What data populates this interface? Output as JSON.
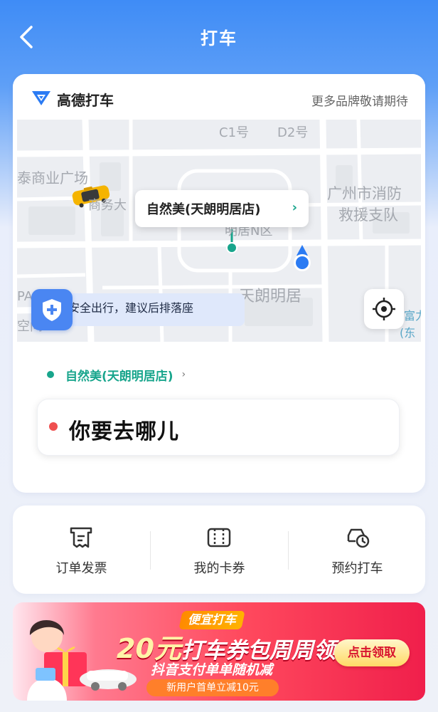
{
  "header": {
    "title": "打车"
  },
  "brand": {
    "name": "高德打车",
    "more_text": "更多品牌敬请期待"
  },
  "map": {
    "labels": {
      "c1": "C1号",
      "d2": "D2号",
      "plaza": "泰商业广场",
      "business": "商务大",
      "fire_station_line1": "广州市消防",
      "fire_station_line2": "救援支队",
      "area": "明居N区",
      "tianlang": "天朗明居",
      "pa": "PA",
      "kong": "空间",
      "right_edge_1": "富力",
      "right_edge_2": "(东"
    },
    "pickup_bubble": "自然美(天朗明居店)",
    "safety_tip": "安全出行，建议后排落座"
  },
  "trip": {
    "origin": "自然美(天朗明居店)",
    "destination_placeholder": "你要去哪儿"
  },
  "actions": [
    {
      "label": "订单发票",
      "icon": "invoice-icon"
    },
    {
      "label": "我的卡券",
      "icon": "coupon-card-icon"
    },
    {
      "label": "预约打车",
      "icon": "scheduled-car-icon"
    }
  ],
  "promo": {
    "tag": "便宜打车",
    "amount": "20元",
    "headline_rest": "打车券包周周领",
    "subline": "抖音支付单单随机减",
    "pill": "新用户首单立减10元",
    "button": "点击领取"
  },
  "colors": {
    "header_blue": "#3f8cf6",
    "origin_green": "#18a58c",
    "destination_red": "#ef4f4f",
    "safety_blue": "#4a86f2",
    "promo_red": "#f01f4b"
  }
}
